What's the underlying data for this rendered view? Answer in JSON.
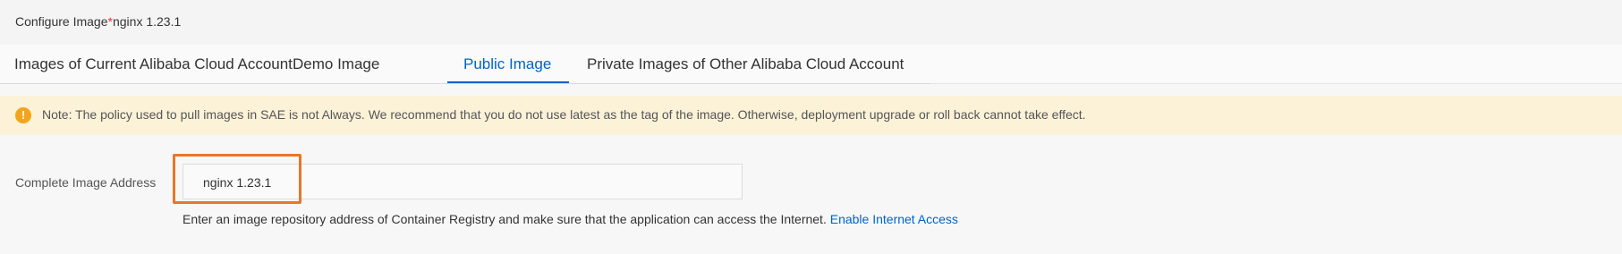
{
  "header": {
    "title_prefix": "Configure Image",
    "required_mark": "*",
    "title_value": "nginx 1.23.1"
  },
  "tabs": [
    {
      "label": "Images of Current Alibaba Cloud Account",
      "active": false
    },
    {
      "label": "Demo Image",
      "active": false
    },
    {
      "label": "Public Image",
      "active": true
    },
    {
      "label": "Private Images of Other Alibaba Cloud Account",
      "active": false
    }
  ],
  "notice": {
    "icon": "warning-icon",
    "icon_glyph": "!",
    "text": "Note: The policy used to pull images in SAE is not Always. We recommend that you do not use latest as the tag of the image. Otherwise, deployment upgrade or roll back cannot take effect."
  },
  "image_address": {
    "label": "Complete Image Address",
    "value": "nginx 1.23.1",
    "help_text": "Enter an image repository address of Container Registry and make sure that the application can access the Internet.",
    "help_link": "Enable Internet Access"
  },
  "colors": {
    "accent": "#0064c8",
    "warning": "#f2a51a",
    "highlight": "#e8762b",
    "notice_bg": "#fbf2d8"
  }
}
